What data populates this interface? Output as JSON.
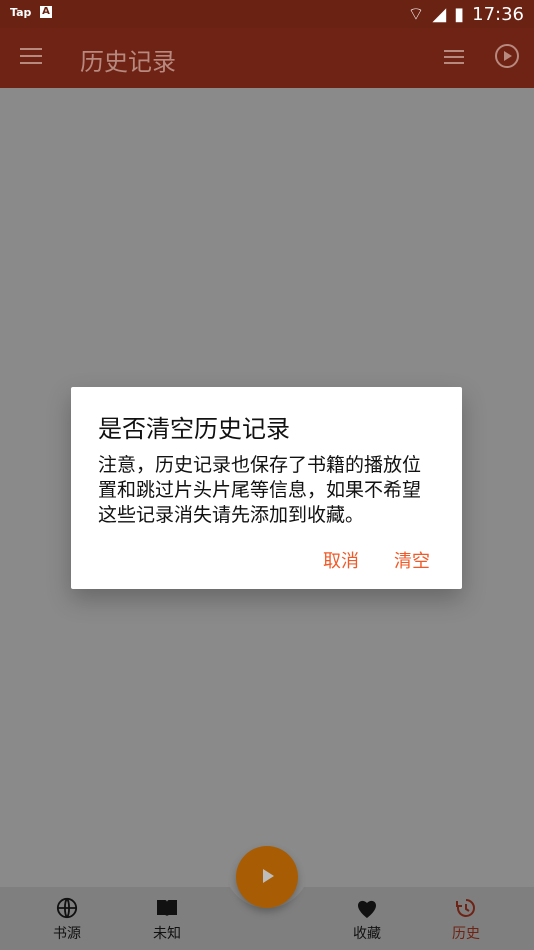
{
  "status": {
    "left_text": "Tap",
    "time": "17:36"
  },
  "toolbar": {
    "title": "历史记录"
  },
  "dialog": {
    "title": "是否清空历史记录",
    "message": "注意，历史记录也保存了书籍的播放位置和跳过片头片尾等信息，如果不希望这些记录消失请先添加到收藏。",
    "cancel": "取消",
    "confirm": "清空"
  },
  "bottom_nav": [
    {
      "label": "书源"
    },
    {
      "label": "未知"
    },
    {
      "label": "收藏"
    },
    {
      "label": "历史"
    }
  ],
  "colors": {
    "accent": "#f05a28",
    "toolbar": "#6e2314",
    "fab": "#a85d04"
  }
}
